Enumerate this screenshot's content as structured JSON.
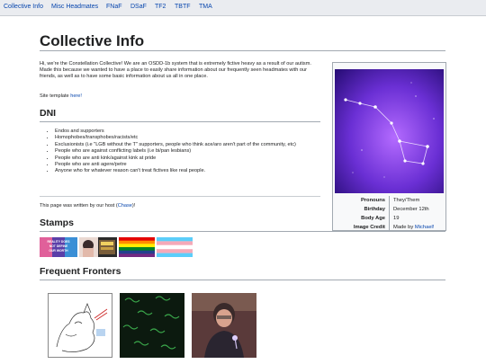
{
  "nav": {
    "items": [
      "Collective Info",
      "Misc Headmates",
      "FNaF",
      "DSaF",
      "TF2",
      "TBTF",
      "TMA"
    ]
  },
  "page": {
    "title": "Collective Info",
    "intro": "Hi, we're the Constellation Collective! We are an OSDD-1b system that is extremely fictive heavy as a result of our autism. Made this because we wanted to have a place to easily share information about our frequently seen headmates with our friends, as well as to have some basic information about us all in one place.",
    "site_template_prefix": "Site template ",
    "site_template_link": "here!",
    "dni_heading": "DNI",
    "dni_items": [
      "Endos and supporters",
      "Homophobes/transphobes/racists/etc",
      "Exclusionists (i.e \"LGB without the T\" supporters, people who think ace/aro aren't part of the community, etc)",
      "People who are against conflicting labels (i.e bi/pan lesbians)",
      "People who are anti kink/against kink at pride",
      "People who are anti agere/petre",
      "Anyone who for whatever reason can't treat fictives like real people."
    ],
    "written_prefix": "This page was written by our host (",
    "written_link": "Chase",
    "written_suffix": ")!",
    "stamps_heading": "Stamps",
    "stamp_text": "REALITY DOES NOT DEFINE OUR WORTH",
    "fronters_heading": "Frequent Fronters"
  },
  "infobox": {
    "rows": [
      {
        "label": "Pronouns",
        "value": "They/Them"
      },
      {
        "label": "Birthday",
        "value": "December 12th"
      },
      {
        "label": "Body Age",
        "value": "19"
      }
    ],
    "credit_label": "Image Credit",
    "credit_prefix": "Made by ",
    "credit_link": "Michael!"
  },
  "colors": {
    "link": "#0645ad",
    "nav_bg": "#eaecf0",
    "infobox_bg": "#f8f9fa",
    "border": "#a2a9b1"
  }
}
